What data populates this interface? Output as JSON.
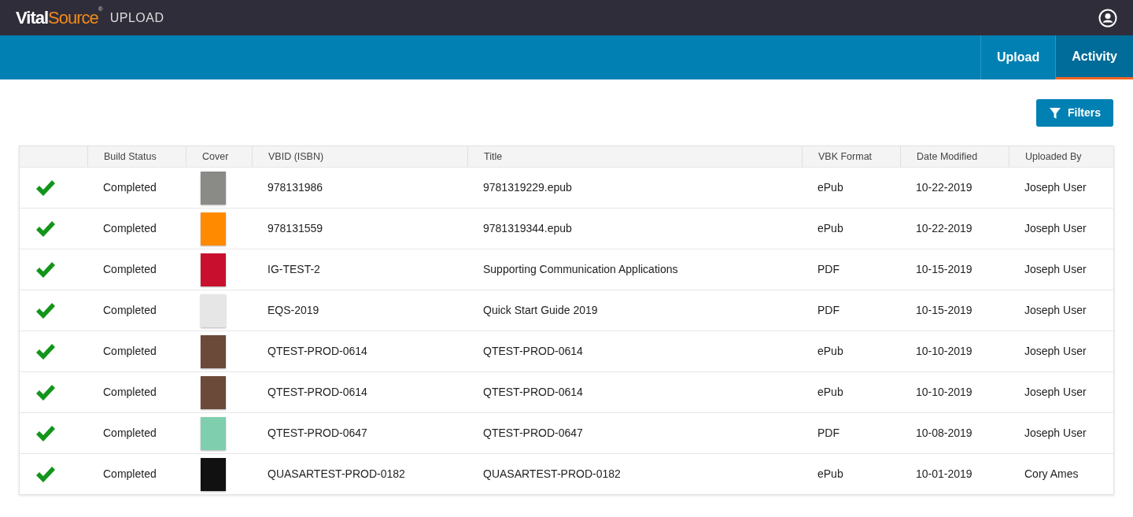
{
  "header": {
    "brand_left": "Vital",
    "brand_right": "Source",
    "brand_mark": "®",
    "product": "UPLOAD"
  },
  "tabs": [
    {
      "label": "Upload",
      "selected": false
    },
    {
      "label": "Activity",
      "selected": true
    }
  ],
  "filters_button": "Filters",
  "table": {
    "columns": [
      "Build Status",
      "Cover",
      "VBID (ISBN)",
      "Title",
      "VBK Format",
      "Date Modified",
      "Uploaded By"
    ],
    "rows": [
      {
        "kind": "success",
        "status": "Completed",
        "color": "#8a8a86",
        "vbid": "978131986",
        "title": "9781319229.epub",
        "format": "ePub",
        "date": "10-22-2019",
        "user": "Joseph User"
      },
      {
        "kind": "success",
        "status": "Completed",
        "color": "#ff8a00",
        "vbid": "978131559",
        "title": "9781319344.epub",
        "format": "ePub",
        "date": "10-22-2019",
        "user": "Joseph User"
      },
      {
        "kind": "success",
        "status": "Completed",
        "color": "#c8102e",
        "vbid": "IG-TEST-2",
        "title": "Supporting Communication Applications",
        "format": "PDF",
        "date": "10-15-2019",
        "user": "Joseph User"
      },
      {
        "kind": "success",
        "status": "Completed",
        "color": "#e6e6e6",
        "vbid": "EQS-2019",
        "title": "Quick Start Guide 2019",
        "format": "PDF",
        "date": "10-15-2019",
        "user": "Joseph User"
      },
      {
        "kind": "success",
        "status": "Completed",
        "color": "#6b4a3a",
        "vbid": "QTEST-PROD-0614",
        "title": "QTEST-PROD-0614",
        "format": "ePub",
        "date": "10-10-2019",
        "user": "Joseph User"
      },
      {
        "kind": "success",
        "status": "Completed",
        "color": "#6b4a3a",
        "vbid": "QTEST-PROD-0614",
        "title": "QTEST-PROD-0614",
        "format": "ePub",
        "date": "10-10-2019",
        "user": "Joseph User"
      },
      {
        "kind": "success",
        "status": "Completed",
        "color": "#7fcfae",
        "vbid": "QTEST-PROD-0647",
        "title": "QTEST-PROD-0647",
        "format": "PDF",
        "date": "10-08-2019",
        "user": "Joseph User"
      },
      {
        "kind": "success",
        "status": "Completed",
        "color": "#111111",
        "vbid": "QUASARTEST-PROD-0182",
        "title": "QUASARTEST-PROD-0182",
        "format": "ePub",
        "date": "10-01-2019",
        "user": "Cory Ames"
      }
    ]
  }
}
